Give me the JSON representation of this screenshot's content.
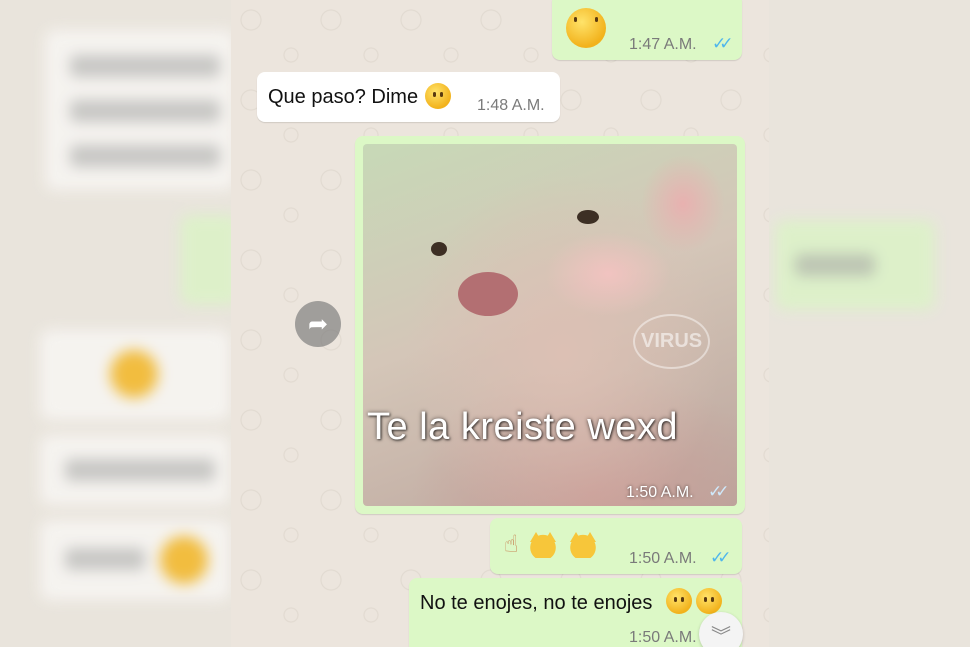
{
  "messages": [
    {
      "id": "m1",
      "direction": "outgoing",
      "emoji": "slightly-smiling-face",
      "time": "1:47 A.M.",
      "status": "read"
    },
    {
      "id": "m2",
      "direction": "incoming",
      "text": "Que paso? Dime",
      "emoji": "downcast-face-with-sweat",
      "time": "1:48 A.M."
    },
    {
      "id": "m3",
      "direction": "outgoing",
      "type": "image",
      "caption": "Te la kreiste wexd",
      "watermark": "VIRUS",
      "time": "1:50 A.M.",
      "status": "read"
    },
    {
      "id": "m4",
      "direction": "outgoing",
      "emoji": "pointing-up-hand, crying-laughing-cat x2",
      "time": "1:50 A.M.",
      "status": "read"
    },
    {
      "id": "m5",
      "direction": "outgoing",
      "text": "No te enojes, no te enojes",
      "emoji": "rolling-on-floor-laughing x2",
      "time": "1:50 A.M."
    }
  ],
  "icons": {
    "forward": "forward-icon",
    "read_ticks": "double-check-icon",
    "scroll_down": "chevron-double-down-icon"
  },
  "colors": {
    "outgoing_bubble": "#dcf8c6",
    "incoming_bubble": "#ffffff",
    "read_ticks": "#4fb6ec",
    "chat_background": "#ece5dd"
  }
}
